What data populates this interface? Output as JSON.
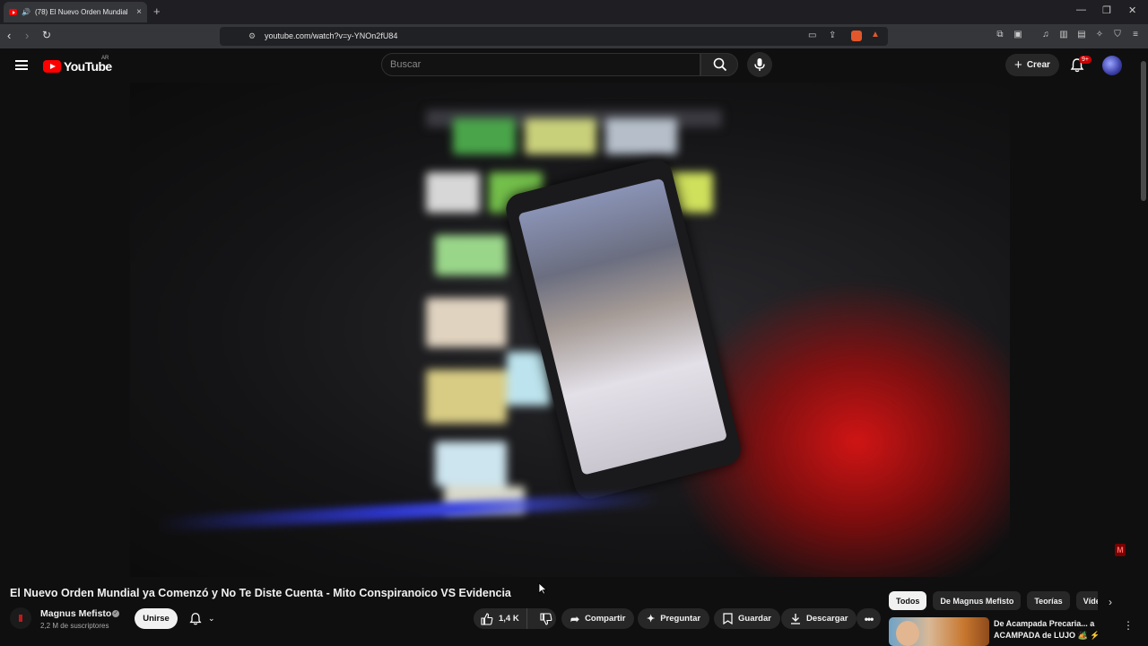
{
  "browser": {
    "tab_title": "(78) El Nuevo Orden Mundial",
    "url": "youtube.com/watch?v=y-YNOn2fU84"
  },
  "header": {
    "logo_text": "YouTube",
    "region": "AR",
    "search_placeholder": "Buscar",
    "create_label": "Crear",
    "notifications_badge": "9+"
  },
  "video": {
    "title": "El Nuevo Orden Mundial ya Comenzó y No Te Diste Cuenta - Mito Conspiranoico VS Evidencia",
    "channel_name": "Magnus Mefisto",
    "subscribers": "2,2 M de suscriptores",
    "join_label": "Unirse",
    "likes": "1,4 K",
    "watermark": "M"
  },
  "actions": {
    "share": "Compartir",
    "ask": "Preguntar",
    "save": "Guardar",
    "download": "Descargar"
  },
  "chips": [
    "Todos",
    "De Magnus Mefisto",
    "Teorías",
    "Vídeos"
  ],
  "recommendation": {
    "title": "De Acampada Precaria... a ACAMPADA de LUJO 🏕️ ⚡"
  },
  "colors": {
    "brand_red": "#ff0000",
    "background": "#0f0f0f",
    "chip_bg": "#272727"
  }
}
